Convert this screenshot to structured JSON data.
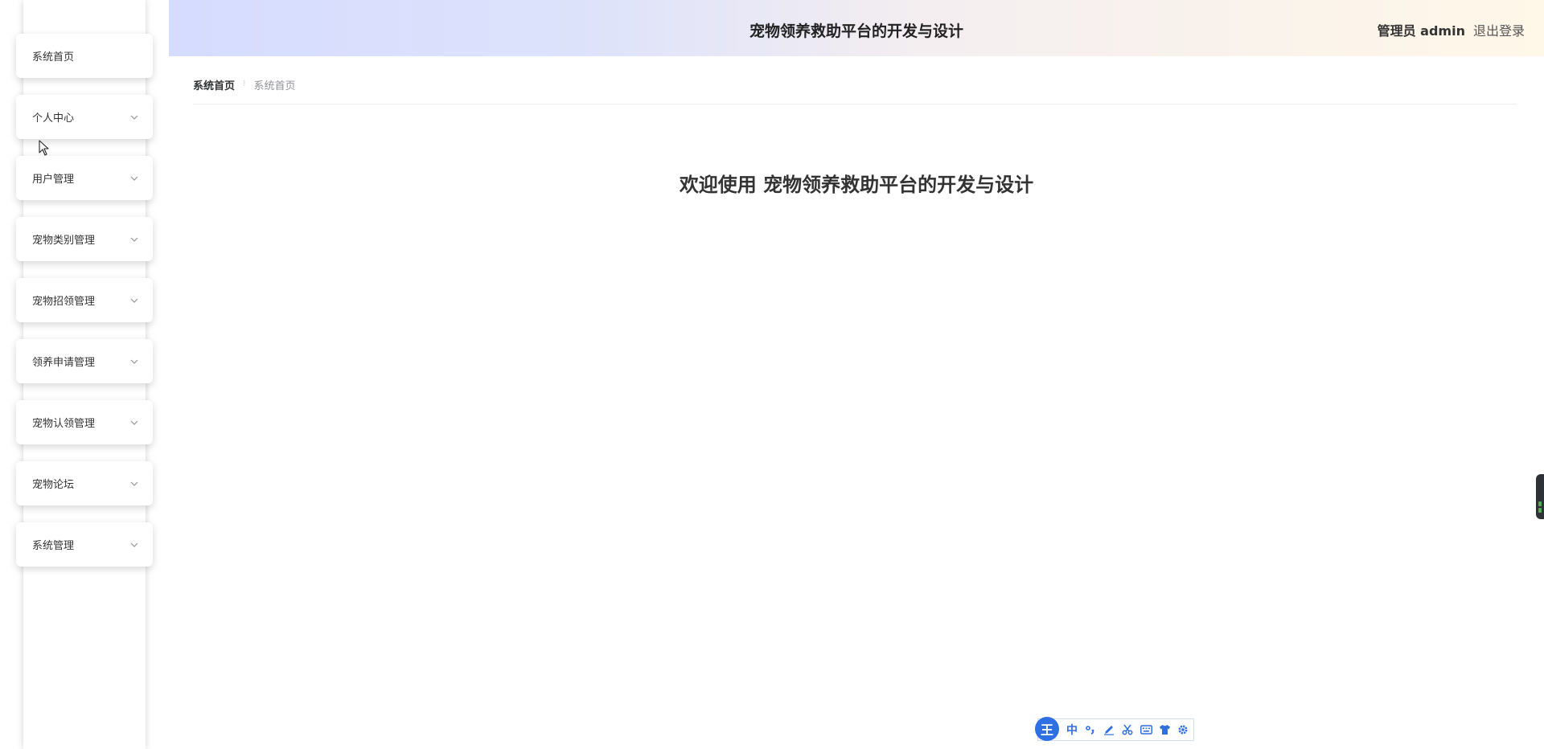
{
  "app": {
    "title": "宠物领养救助平台的开发与设计"
  },
  "header": {
    "admin_label": "管理员 admin",
    "logout_label": "退出登录"
  },
  "sidebar": {
    "items": [
      {
        "label": "系统首页",
        "has_submenu": false
      },
      {
        "label": "个人中心",
        "has_submenu": true
      },
      {
        "label": "用户管理",
        "has_submenu": true
      },
      {
        "label": "宠物类别管理",
        "has_submenu": true
      },
      {
        "label": "宠物招领管理",
        "has_submenu": true
      },
      {
        "label": "领养申请管理",
        "has_submenu": true
      },
      {
        "label": "宠物认领管理",
        "has_submenu": true
      },
      {
        "label": "宠物论坛",
        "has_submenu": true
      },
      {
        "label": "系统管理",
        "has_submenu": true
      }
    ]
  },
  "breadcrumb": {
    "items": [
      "系统首页",
      "系统首页"
    ],
    "separator": "⁝"
  },
  "main": {
    "welcome_text": "欢迎使用 宠物领养救助平台的开发与设计"
  },
  "ime_toolbar": {
    "logo": "王",
    "mode": "中",
    "tools": [
      "punctuation-icon",
      "pen-icon",
      "scissors-icon",
      "keyboard-icon",
      "skin-icon",
      "settings-icon"
    ]
  },
  "colors": {
    "header_gradient_start": "#d6dcff",
    "header_gradient_end": "#fff7e8",
    "ime_accent": "#2f6fe4"
  }
}
